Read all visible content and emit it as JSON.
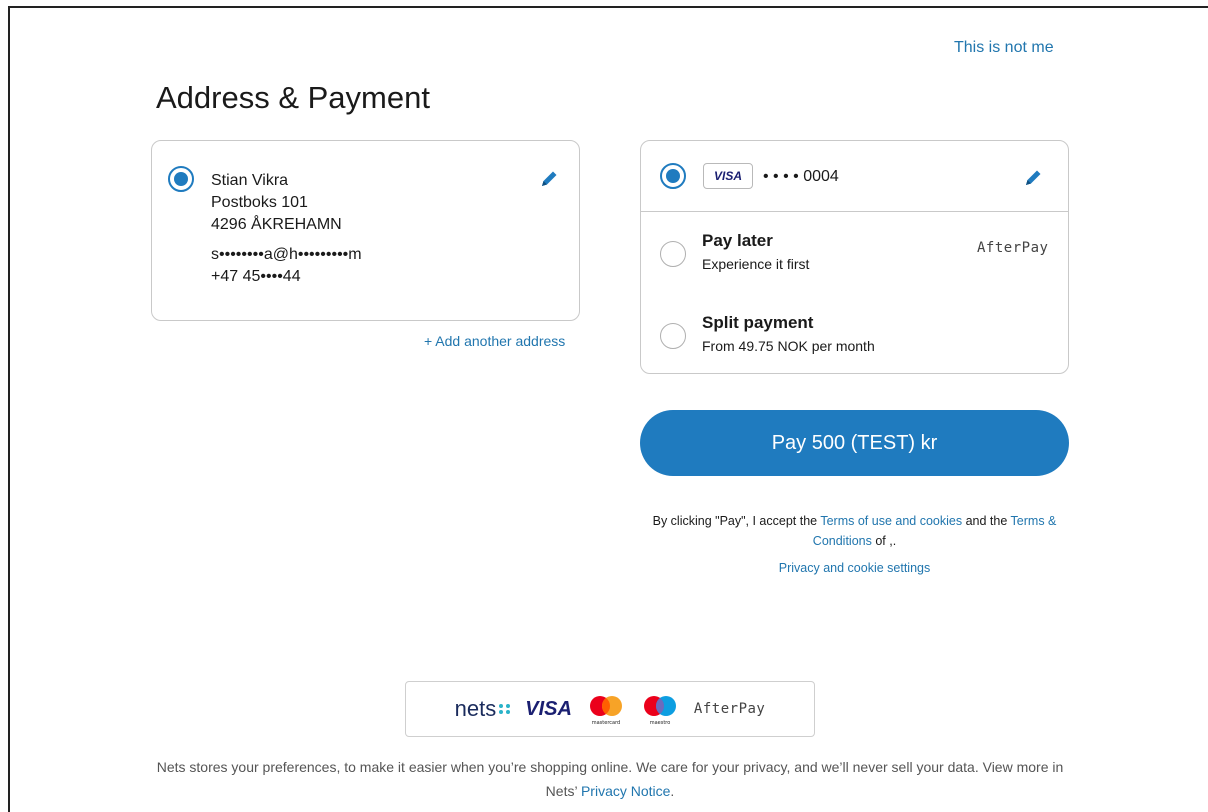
{
  "header": {
    "not_me_link": "This is not me",
    "title": "Address & Payment"
  },
  "address": {
    "name": "Stian Vikra",
    "street": "Postboks 101",
    "postal": "4296 ÅKREHAMN",
    "email": "s••••••••a@h•••••••••m",
    "phone": "+47 45••••44",
    "edit_icon": "pencil-icon",
    "add_link": "+ Add another address"
  },
  "payment": {
    "card_brand": "VISA",
    "card_number": "• • • • 0004",
    "edit_icon": "pencil-icon",
    "options": [
      {
        "title": "Pay later",
        "subtitle": "Experience it first",
        "logo": "AfterPay"
      },
      {
        "title": "Split payment",
        "subtitle": "From 49.75 NOK per month"
      }
    ],
    "pay_button": "Pay 500 (TEST) kr",
    "legal": {
      "prefix": "By clicking \"Pay\", I accept the ",
      "terms_link": "Terms of use and cookies",
      "middle": " and the ",
      "conditions_link": "Terms & Conditions",
      "suffix": " of ,."
    },
    "privacy_settings": "Privacy and cookie settings"
  },
  "logos": {
    "nets": "nets",
    "visa": "VISA",
    "mastercard": "mastercard",
    "maestro": "maestro",
    "afterpay": "AfterPay"
  },
  "footer": {
    "text": "Nets stores your preferences, to make it easier when you’re shopping online. We care for your privacy, and we’ll never sell your data. View more in Nets’ ",
    "privacy_link": "Privacy Notice",
    "period": "."
  },
  "colors": {
    "accent": "#1f7bbf",
    "link": "#2176ae"
  }
}
